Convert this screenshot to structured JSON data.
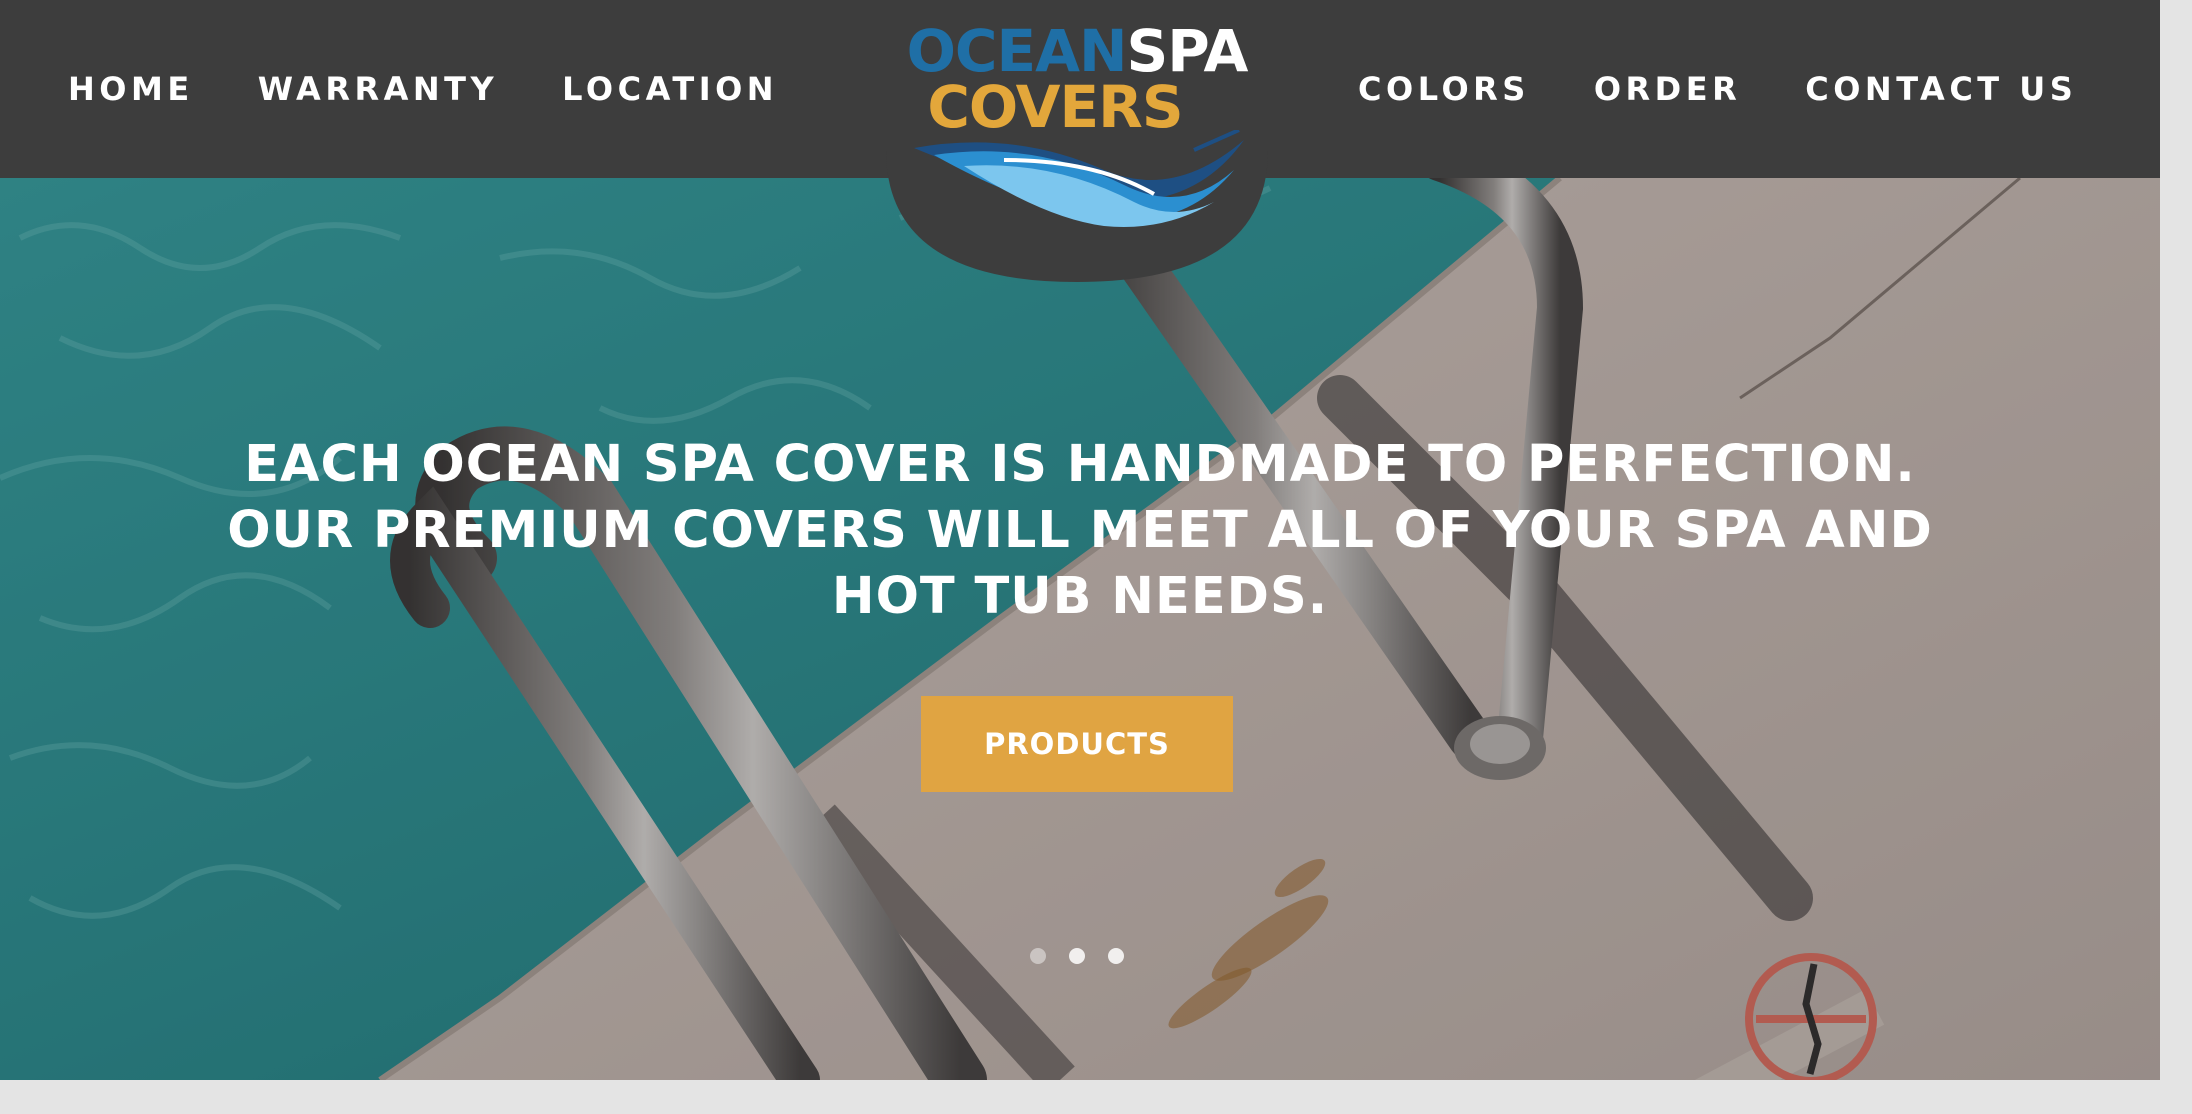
{
  "nav": {
    "left": [
      {
        "label": "HOME"
      },
      {
        "label": "WARRANTY"
      },
      {
        "label": "LOCATION"
      }
    ],
    "right": [
      {
        "label": "COLORS"
      },
      {
        "label": "ORDER"
      },
      {
        "label": "CONTACT US"
      }
    ]
  },
  "logo": {
    "word_ocean": "OCEAN",
    "word_spa": "SPA",
    "word_covers": "COVERS"
  },
  "hero": {
    "headline": "EACH OCEAN SPA COVER IS HANDMADE TO PERFECTION. OUR PREMIUM COVERS WILL MEET ALL OF YOUR SPA AND HOT TUB NEEDS.",
    "cta_label": "PRODUCTS",
    "slides": {
      "count": 3,
      "active_index": 1
    }
  },
  "colors": {
    "header_bg": "#3d3d3d",
    "accent_gold": "#e0a442",
    "logo_blue": "#1f6fa6",
    "pool_teal": "#2a9a9c",
    "deck": "#d8c9bf"
  },
  "icons": {
    "no_diving_sign": "no-diving-icon"
  }
}
